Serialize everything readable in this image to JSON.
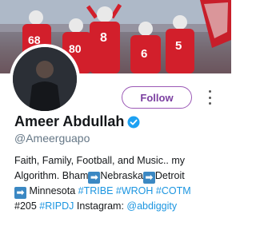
{
  "profile": {
    "display_name": "Ameer Abdullah",
    "handle": "@Ameerguapo",
    "follow_label": "Follow",
    "verified": true
  },
  "bio": {
    "line1": "Faith, Family, Football, and Music.. my",
    "line2_a": "Algorithm. Bham",
    "line2_b": "Nebraska",
    "line2_c": "Detroit",
    "line3_a": "Minnesota",
    "hashtag_1": "#TRIBE",
    "hashtag_2": "#WROH",
    "hashtag_3": "#COTM",
    "line4_a": "#205",
    "hashtag_4": "#RIPDJ",
    "instagram_label": "Instagram:",
    "instagram_handle": "@abdiggity"
  },
  "banner": {
    "jersey_numbers": [
      "68",
      "8",
      "80",
      "6",
      "5"
    ]
  },
  "colors": {
    "follow_border": "#9b59b6",
    "link": "#1b95e0",
    "verified": "#1da1f2",
    "arrow_emoji": "#3b88c3",
    "jersey_red": "#d21f2b"
  },
  "icons": {
    "verified": "verified-badge-icon",
    "arrow": "right-arrow-emoji-icon",
    "more": "more-vertical-icon"
  }
}
